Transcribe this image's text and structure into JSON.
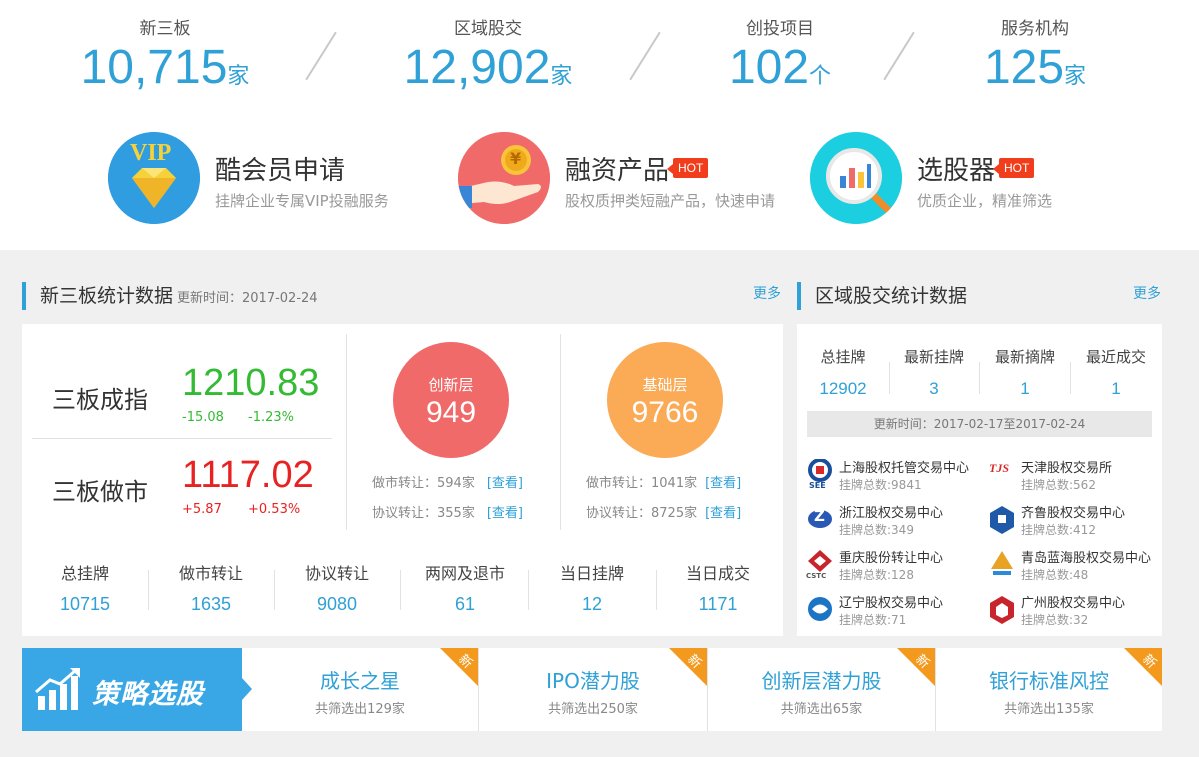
{
  "stats": [
    {
      "label": "新三板",
      "value": "10,715",
      "unit": "家"
    },
    {
      "label": "区域股交",
      "value": "12,902",
      "unit": "家"
    },
    {
      "label": "创投项目",
      "value": "102",
      "unit": "个"
    },
    {
      "label": "服务机构",
      "value": "125",
      "unit": "家"
    }
  ],
  "features": [
    {
      "title": "酷会员申请",
      "desc": "挂牌企业专属VIP投融服务",
      "badge": "",
      "icon": "vip-diamond-icon"
    },
    {
      "title": "融资产品",
      "desc": "股权质押类短融产品，快速申请",
      "badge": "HOT",
      "icon": "hand-coin-icon"
    },
    {
      "title": "选股器",
      "desc": "优质企业，精准筛选",
      "badge": "HOT",
      "icon": "magnifier-chart-icon"
    }
  ],
  "vip_text": "VIP",
  "coin_text": "¥",
  "left_section": {
    "title": "新三板统计数据",
    "updated": "更新时间：2017-02-24",
    "more": "更多",
    "indices": [
      {
        "name": "三板成指",
        "value": "1210.83",
        "change": "-15.08",
        "pct": "-1.23%"
      },
      {
        "name": "三板做市",
        "value": "1117.02",
        "change": "+5.87",
        "pct": "+0.53%"
      }
    ],
    "tiers": [
      {
        "name": "创新层",
        "value": "949",
        "mm": "做市转让：594家",
        "ag": "协议转让：355家",
        "link": "[查看]",
        "color": "#f06a6a"
      },
      {
        "name": "基础层",
        "value": "9766",
        "mm": "做市转让：1041家",
        "ag": "协议转让：8725家",
        "link": "[查看]",
        "color": "#fbaa55"
      }
    ],
    "summary": [
      {
        "label": "总挂牌",
        "value": "10715"
      },
      {
        "label": "做市转让",
        "value": "1635"
      },
      {
        "label": "协议转让",
        "value": "9080"
      },
      {
        "label": "两网及退市",
        "value": "61"
      },
      {
        "label": "当日挂牌",
        "value": "12"
      },
      {
        "label": "当日成交",
        "value": "1171"
      }
    ]
  },
  "right_section": {
    "title": "区域股交统计数据",
    "more": "更多",
    "summary": [
      {
        "label": "总挂牌",
        "value": "12902"
      },
      {
        "label": "最新挂牌",
        "value": "3"
      },
      {
        "label": "最新摘牌",
        "value": "1"
      },
      {
        "label": "最近成交",
        "value": "1"
      }
    ],
    "updated": "更新时间：2017-02-17至2017-02-24",
    "exchanges": [
      {
        "name": "上海股权托管交易中心",
        "count": "挂牌总数:9841",
        "logo_text": "SEE",
        "color": "#1a4f9c"
      },
      {
        "name": "天津股权交易所",
        "count": "挂牌总数:562",
        "logo_text": "TJS",
        "color": "#d62b2b"
      },
      {
        "name": "浙江股权交易中心",
        "count": "挂牌总数:349",
        "logo_text": "Z",
        "color": "#2a58b5"
      },
      {
        "name": "齐鲁股权交易中心",
        "count": "挂牌总数:412",
        "logo_text": "",
        "color": "#1e5aa8"
      },
      {
        "name": "重庆股份转让中心",
        "count": "挂牌总数:128",
        "logo_text": "CSTC",
        "color": "#c8242c"
      },
      {
        "name": "青岛蓝海股权交易中心",
        "count": "挂牌总数:48",
        "logo_text": "",
        "color": "#e8a224"
      },
      {
        "name": "辽宁股权交易中心",
        "count": "挂牌总数:71",
        "logo_text": "",
        "color": "#1c74c4"
      },
      {
        "name": "广州股权交易中心",
        "count": "挂牌总数:32",
        "logo_text": "",
        "color": "#c8242c"
      }
    ]
  },
  "strategy": {
    "label": "策略选股",
    "items": [
      {
        "title": "成长之星",
        "desc": "共筛选出129家",
        "badge": "新"
      },
      {
        "title": "IPO潜力股",
        "desc": "共筛选出250家",
        "badge": "新"
      },
      {
        "title": "创新层潜力股",
        "desc": "共筛选出65家",
        "badge": "新"
      },
      {
        "title": "银行标准风控",
        "desc": "共筛选出135家",
        "badge": "新"
      }
    ]
  }
}
